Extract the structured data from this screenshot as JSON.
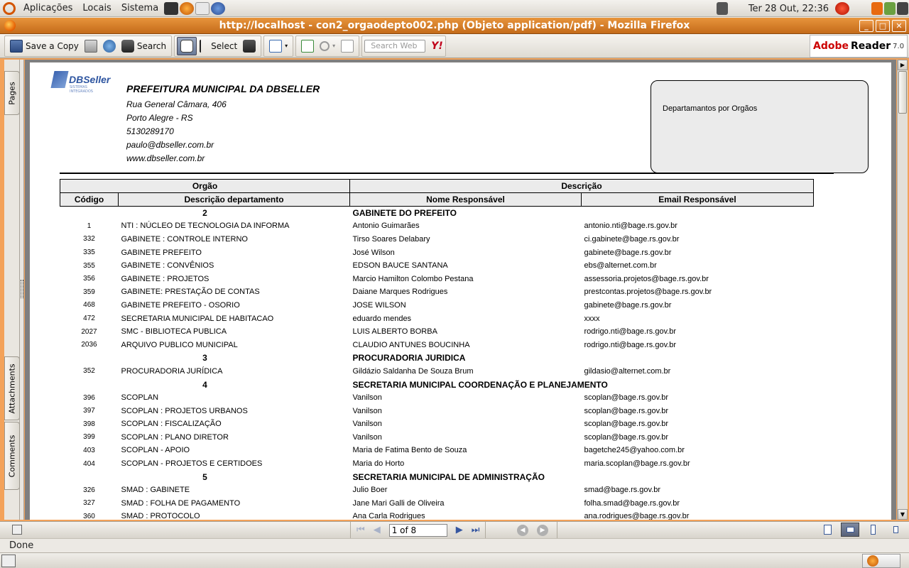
{
  "top_panel": {
    "menus": [
      "Aplicações",
      "Locais",
      "Sistema"
    ],
    "clock": "Ter 28 Out, 22:36"
  },
  "window": {
    "title": "http://localhost - con2_orgaodepto002.php (Objeto application/pdf) - Mozilla Firefox"
  },
  "toolbar": {
    "save_copy": "Save a Copy",
    "search": "Search",
    "select": "Select",
    "search_web_placeholder": "Search Web",
    "yahoo": "Y!",
    "brand_adobe": "Adobe",
    "brand_reader": "Reader",
    "brand_version": "7.0"
  },
  "side_tabs": {
    "pages": "Pages",
    "attachments": "Attachments",
    "comments": "Comments"
  },
  "header": {
    "org": "PREFEITURA MUNICIPAL DA DBSELLER",
    "address": "Rua General Câmara, 406",
    "city": "Porto Alegre - RS",
    "phone": "5130289170",
    "email": "paulo@dbseller.com.br",
    "site": "www.dbseller.com.br",
    "logo_text": "DBSeller",
    "logo_sub": "SISTEMAS INTEGRADOS",
    "report_title": "Departamantos por Orgãos"
  },
  "table": {
    "group_headers": [
      "Orgão",
      "Descrição"
    ],
    "columns": [
      "Código",
      "Descrição departamento",
      "Nome Responsável",
      "Email Responsável"
    ],
    "groups": [
      {
        "code": "2",
        "name": "GABINETE DO PREFEITO",
        "rows": [
          [
            "1",
            "NTI : NÚCLEO DE TECNOLOGIA DA INFORMA",
            "Antonio Guimarães",
            "antonio.nti@bage.rs.gov.br"
          ],
          [
            "332",
            "GABINETE : CONTROLE INTERNO",
            "Tirso Soares Delabary",
            "ci.gabinete@bage.rs.gov.br"
          ],
          [
            "335",
            "GABINETE PREFEITO",
            "José Wilson",
            "gabinete@bage.rs.gov.br"
          ],
          [
            "355",
            "GABINETE : CONVÊNIOS",
            "EDSON BAUCE SANTANA",
            "ebs@alternet.com.br"
          ],
          [
            "356",
            "GABINETE : PROJETOS",
            "Marcio Hamilton Colombo Pestana",
            "assessoria.projetos@bage.rs.gov.br"
          ],
          [
            "359",
            "GABINETE: PRESTAÇÃO DE CONTAS",
            "Daiane Marques Rodrigues",
            "prestcontas.projetos@bage.rs.gov.br"
          ],
          [
            "468",
            "GABINETE PREFEITO -  OSORIO",
            "JOSE WILSON",
            "gabinete@bage.rs.gov.br"
          ],
          [
            "472",
            "SECRETARIA MUNICIPAL DE HABITACAO",
            "eduardo mendes",
            "xxxx"
          ],
          [
            "2027",
            "SMC - BIBLIOTECA PUBLICA",
            "LUIS ALBERTO BORBA",
            "rodrigo.nti@bage.rs.gov.br"
          ],
          [
            "2036",
            "ARQUIVO PUBLICO MUNICIPAL",
            "CLAUDIO ANTUNES BOUCINHA",
            "rodrigo.nti@bage.rs.gov.br"
          ]
        ]
      },
      {
        "code": "3",
        "name": "PROCURADORIA JURIDICA",
        "rows": [
          [
            "352",
            "PROCURADORIA JURÍDICA",
            "Gildázio Saldanha De Souza Brum",
            "gildasio@alternet.com.br"
          ]
        ]
      },
      {
        "code": "4",
        "name": "SECRETARIA MUNICIPAL COORDENAÇÃO E PLANEJAMENTO",
        "rows": [
          [
            "396",
            "SCOPLAN",
            "Vanilson",
            "scoplan@bage.rs.gov.br"
          ],
          [
            "397",
            "SCOPLAN : PROJETOS URBANOS",
            "Vanilson",
            "scoplan@bage.rs.gov.br"
          ],
          [
            "398",
            "SCOPLAN : FISCALIZAÇÃO",
            "Vanilson",
            "scoplan@bage.rs.gov.br"
          ],
          [
            "399",
            "SCOPLAN : PLANO DIRETOR",
            "Vanilson",
            "scoplan@bage.rs.gov.br"
          ],
          [
            "403",
            "SCOPLAN - APOIO",
            "Maria de Fatima Bento de Souza",
            "bagetche245@yahoo.com.br"
          ],
          [
            "404",
            "SCOPLAN - PROJETOS E CERTIDOES",
            "Maria do Horto",
            "maria.scoplan@bage.rs.gov.br"
          ]
        ]
      },
      {
        "code": "5",
        "name": "SECRETARIA MUNICIPAL DE ADMINISTRAÇÃO",
        "rows": [
          [
            "326",
            "SMAD : GABINETE",
            "Julio Boer",
            "smad@bage.rs.gov.br"
          ],
          [
            "327",
            "SMAD : FOLHA DE PAGAMENTO",
            "Jane Mari Galli de Oliveira",
            "folha.smad@bage.rs.gov.br"
          ],
          [
            "360",
            "SMAD : PROTOCOLO",
            "Ana Carla Rodrigues",
            "ana.rodrigues@bage.rs.gov.br"
          ]
        ]
      }
    ]
  },
  "navbar": {
    "page_value": "1 of 8"
  },
  "status": {
    "text": "Done"
  },
  "colors": {
    "firefox_title": "#d47a28",
    "frame": "#f3a25a",
    "table_header": "#ebebeb"
  }
}
